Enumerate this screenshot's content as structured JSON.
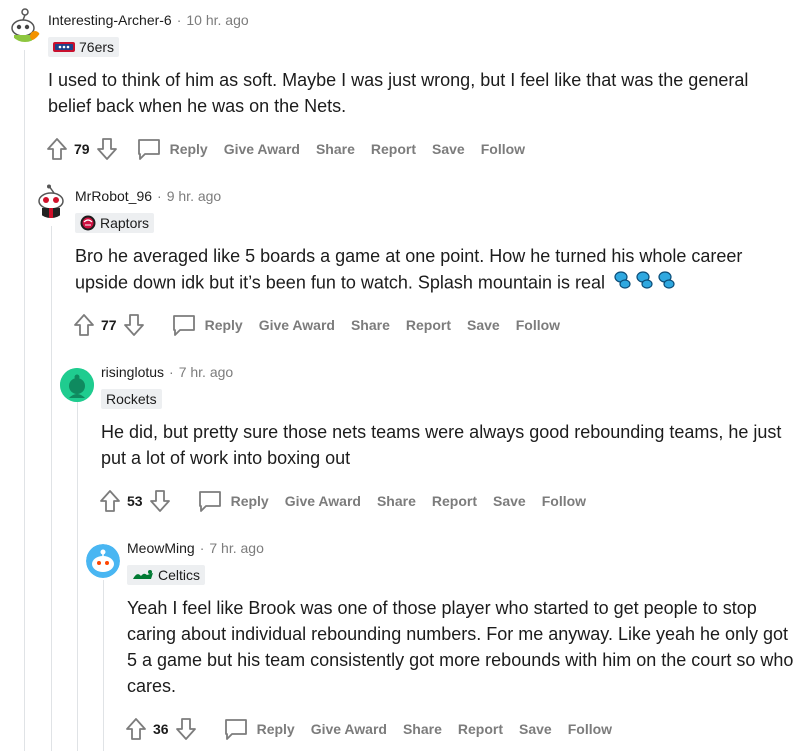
{
  "comments": [
    {
      "username": "Interesting-Archer-6",
      "time": "10 hr. ago",
      "flair": "76ers",
      "body": "I used to think of him as soft. Maybe I was just wrong, but I feel like that was the general belief back when he was on the Nets.",
      "votes": "79",
      "actions": {
        "reply": "Reply",
        "give_award": "Give Award",
        "share": "Share",
        "report": "Report",
        "save": "Save",
        "follow": "Follow"
      }
    },
    {
      "username": "MrRobot_96",
      "time": "9 hr. ago",
      "flair": "Raptors",
      "body": "Bro he averaged like 5 boards a game at one point. How he turned his whole career upside down idk but it’s been fun to watch. Splash mountain is real",
      "votes": "77",
      "actions": {
        "reply": "Reply",
        "give_award": "Give Award",
        "share": "Share",
        "report": "Report",
        "save": "Save",
        "follow": "Follow"
      }
    },
    {
      "username": "risinglotus",
      "time": "7 hr. ago",
      "flair": "Rockets",
      "body": "He did, but pretty sure those nets teams were always good rebounding teams, he just put a lot of work into boxing out",
      "votes": "53",
      "actions": {
        "reply": "Reply",
        "give_award": "Give Award",
        "share": "Share",
        "report": "Report",
        "save": "Save",
        "follow": "Follow"
      }
    },
    {
      "username": "MeowMing",
      "time": "7 hr. ago",
      "flair": "Celtics",
      "body": "Yeah I feel like Brook was one of those player who started to get people to stop caring about individual rebounding numbers. For me anyway. Like yeah he only got 5 a game but his team consistently got more rebounds with him on the court so who cares.",
      "votes": "36",
      "actions": {
        "reply": "Reply",
        "give_award": "Give Award",
        "share": "Share",
        "report": "Report",
        "save": "Save",
        "follow": "Follow"
      }
    }
  ],
  "separator": "·",
  "icons": [
    "upvote-icon",
    "downvote-icon",
    "comment-icon",
    "splash-droplets-icon",
    "76ers-logo-icon",
    "raptors-logo-icon",
    "celtics-logo-icon"
  ],
  "colors": {
    "text": "#1c1c1c",
    "meta": "#7c7c7c",
    "flair_bg": "#edeff1",
    "thread_line": "#e0e3e6",
    "risinglotus_avatar": "#1fcc8f",
    "meowming_avatar": "#49b6f2",
    "droplet": "#2fa8e0"
  }
}
